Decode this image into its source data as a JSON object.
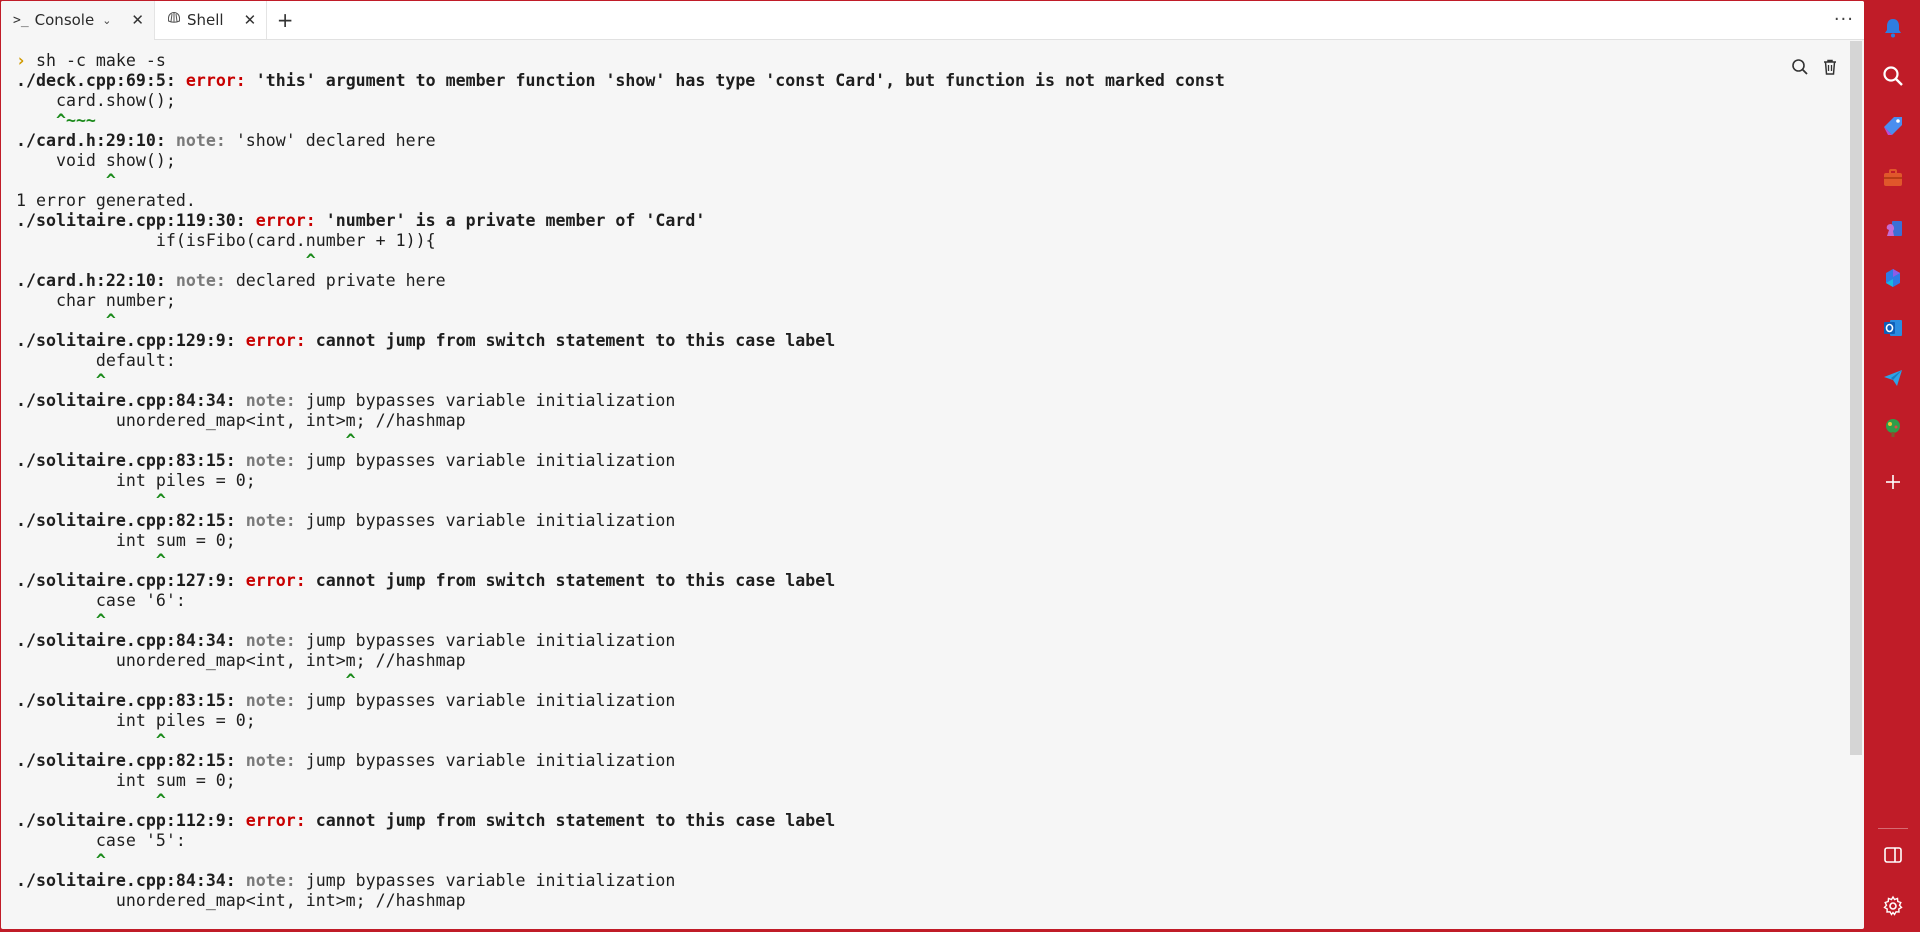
{
  "tabs": [
    {
      "icon": "terminal-icon",
      "glyph": ">_",
      "label": "Console",
      "active": true
    },
    {
      "icon": "shell-icon",
      "label": "Shell",
      "active": false
    }
  ],
  "new_tab_label": "+",
  "more_label": "···",
  "colors": {
    "frame": "#c01c28",
    "error": "#c80000",
    "note": "#7a7a7a",
    "caret": "#1b8a1b",
    "prompt": "#d09a00"
  },
  "console": {
    "lines": [
      [
        {
          "t": "› ",
          "c": "prompt"
        },
        {
          "t": "sh -c make -s"
        }
      ],
      [
        {
          "t": "./deck.cpp:69:5: ",
          "c": "b"
        },
        {
          "t": "error: ",
          "c": "err"
        },
        {
          "t": "'this' argument to member function 'show' has type 'const Card', but function is not marked const",
          "c": "b"
        }
      ],
      [
        {
          "t": "    card.show();"
        }
      ],
      [
        {
          "t": "    ^~~~",
          "c": "caret"
        }
      ],
      [
        {
          "t": "./card.h:29:10: ",
          "c": "b"
        },
        {
          "t": "note: ",
          "c": "note"
        },
        {
          "t": "'show' declared here"
        }
      ],
      [
        {
          "t": "    void show();"
        }
      ],
      [
        {
          "t": "         ^",
          "c": "caret"
        }
      ],
      [
        {
          "t": "1 error generated."
        }
      ],
      [
        {
          "t": "./solitaire.cpp:119:30: ",
          "c": "b"
        },
        {
          "t": "error: ",
          "c": "err"
        },
        {
          "t": "'number' is a private member of 'Card'",
          "c": "b"
        }
      ],
      [
        {
          "t": "              if(isFibo(card.number + 1)){"
        }
      ],
      [
        {
          "t": "                             ^",
          "c": "caret"
        }
      ],
      [
        {
          "t": "./card.h:22:10: ",
          "c": "b"
        },
        {
          "t": "note: ",
          "c": "note"
        },
        {
          "t": "declared private here"
        }
      ],
      [
        {
          "t": "    char number;"
        }
      ],
      [
        {
          "t": "         ^",
          "c": "caret"
        }
      ],
      [
        {
          "t": "./solitaire.cpp:129:9: ",
          "c": "b"
        },
        {
          "t": "error: ",
          "c": "err"
        },
        {
          "t": "cannot jump from switch statement to this case label",
          "c": "b"
        }
      ],
      [
        {
          "t": "        default:"
        }
      ],
      [
        {
          "t": "        ^",
          "c": "caret"
        }
      ],
      [
        {
          "t": "./solitaire.cpp:84:34: ",
          "c": "b"
        },
        {
          "t": "note: ",
          "c": "note"
        },
        {
          "t": "jump bypasses variable initialization"
        }
      ],
      [
        {
          "t": "          unordered_map<int, int>m; //hashmap"
        }
      ],
      [
        {
          "t": "                                 ^",
          "c": "caret"
        }
      ],
      [
        {
          "t": "./solitaire.cpp:83:15: ",
          "c": "b"
        },
        {
          "t": "note: ",
          "c": "note"
        },
        {
          "t": "jump bypasses variable initialization"
        }
      ],
      [
        {
          "t": "          int piles = 0;"
        }
      ],
      [
        {
          "t": "              ^",
          "c": "caret"
        }
      ],
      [
        {
          "t": "./solitaire.cpp:82:15: ",
          "c": "b"
        },
        {
          "t": "note: ",
          "c": "note"
        },
        {
          "t": "jump bypasses variable initialization"
        }
      ],
      [
        {
          "t": "          int sum = 0;"
        }
      ],
      [
        {
          "t": "              ^",
          "c": "caret"
        }
      ],
      [
        {
          "t": "./solitaire.cpp:127:9: ",
          "c": "b"
        },
        {
          "t": "error: ",
          "c": "err"
        },
        {
          "t": "cannot jump from switch statement to this case label",
          "c": "b"
        }
      ],
      [
        {
          "t": "        case '6':"
        }
      ],
      [
        {
          "t": "        ^",
          "c": "caret"
        }
      ],
      [
        {
          "t": "./solitaire.cpp:84:34: ",
          "c": "b"
        },
        {
          "t": "note: ",
          "c": "note"
        },
        {
          "t": "jump bypasses variable initialization"
        }
      ],
      [
        {
          "t": "          unordered_map<int, int>m; //hashmap"
        }
      ],
      [
        {
          "t": "                                 ^",
          "c": "caret"
        }
      ],
      [
        {
          "t": "./solitaire.cpp:83:15: ",
          "c": "b"
        },
        {
          "t": "note: ",
          "c": "note"
        },
        {
          "t": "jump bypasses variable initialization"
        }
      ],
      [
        {
          "t": "          int piles = 0;"
        }
      ],
      [
        {
          "t": "              ^",
          "c": "caret"
        }
      ],
      [
        {
          "t": "./solitaire.cpp:82:15: ",
          "c": "b"
        },
        {
          "t": "note: ",
          "c": "note"
        },
        {
          "t": "jump bypasses variable initialization"
        }
      ],
      [
        {
          "t": "          int sum = 0;"
        }
      ],
      [
        {
          "t": "              ^",
          "c": "caret"
        }
      ],
      [
        {
          "t": "./solitaire.cpp:112:9: ",
          "c": "b"
        },
        {
          "t": "error: ",
          "c": "err"
        },
        {
          "t": "cannot jump from switch statement to this case label",
          "c": "b"
        }
      ],
      [
        {
          "t": "        case '5':"
        }
      ],
      [
        {
          "t": "        ^",
          "c": "caret"
        }
      ],
      [
        {
          "t": "./solitaire.cpp:84:34: ",
          "c": "b"
        },
        {
          "t": "note: ",
          "c": "note"
        },
        {
          "t": "jump bypasses variable initialization"
        }
      ],
      [
        {
          "t": "          unordered_map<int, int>m; //hashmap"
        }
      ]
    ]
  },
  "console_tools": [
    "search-icon",
    "trash-icon"
  ],
  "sidebar_icons": [
    "bell-icon",
    "search-icon",
    "tag-icon",
    "briefcase-icon",
    "chess-icon",
    "copilot-icon",
    "outlook-icon",
    "send-icon",
    "tree-icon",
    "plus-icon",
    "panel-icon",
    "gear-icon"
  ]
}
